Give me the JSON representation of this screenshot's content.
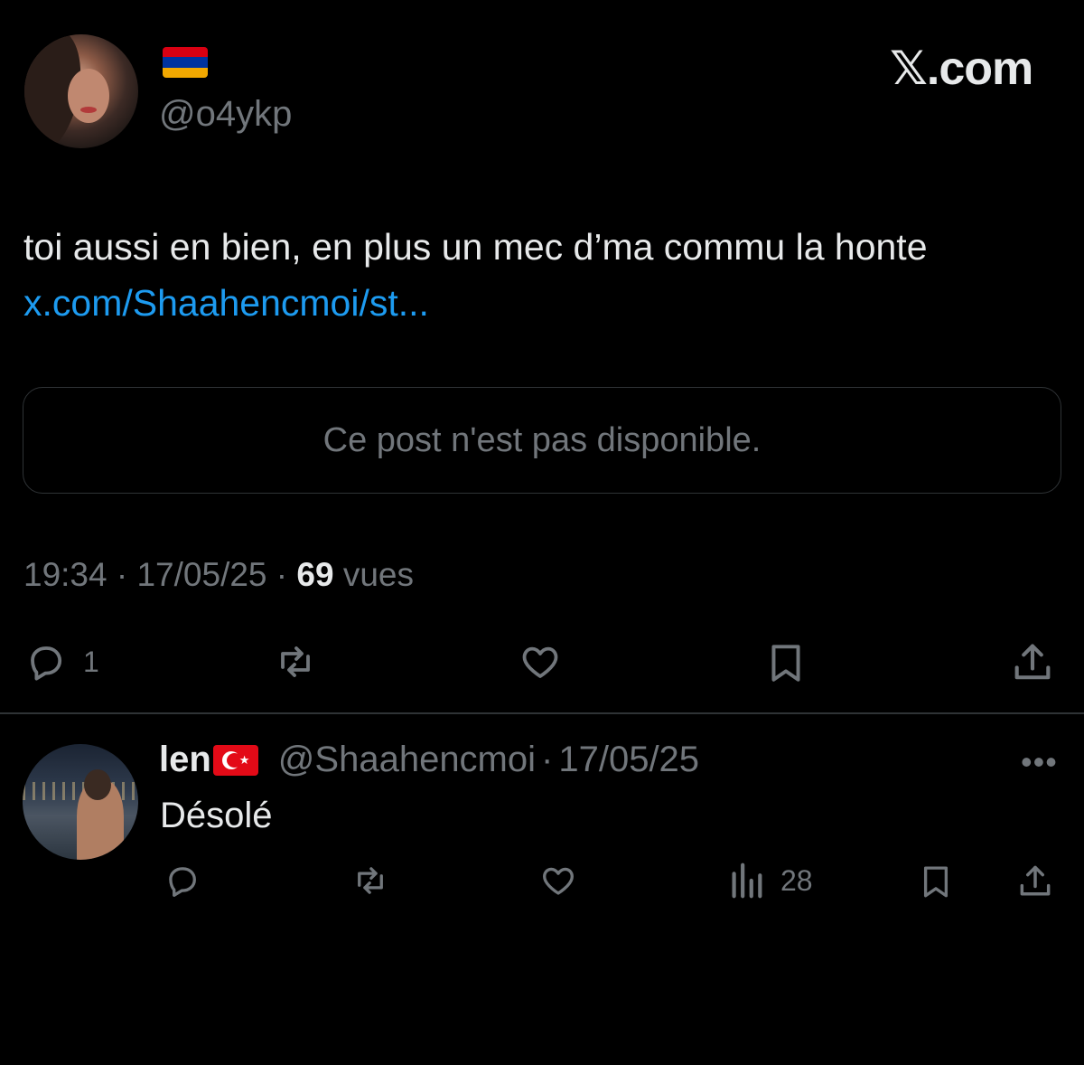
{
  "post": {
    "handle": "@o4ykp",
    "flag_colors": [
      "#d90012",
      "#0033a0",
      "#f2a800"
    ],
    "brand": "𝕏.com",
    "text": "toi aussi en bien, en plus un mec d’ma commu la honte ",
    "link": "x.com/Shaahencmoi/st...",
    "quote_unavailable": "Ce post n'est pas disponible.",
    "time": "19:34",
    "date": "17/05/25",
    "separator": "·",
    "views_count": "69",
    "views_label": "vues",
    "actions": {
      "reply_icon": "reply-icon",
      "reply_count": "1",
      "repost_icon": "repost-icon",
      "like_icon": "like-icon",
      "bookmark_icon": "bookmark-icon",
      "share_icon": "share-icon"
    }
  },
  "reply": {
    "name": "len",
    "flag": "turkey-flag",
    "handle": "@Shaahencmoi",
    "separator": "·",
    "date": "17/05/25",
    "more": "•••",
    "text": "Désolé",
    "views_count": "28"
  },
  "colors": {
    "background": "#000000",
    "text": "#e7e9ea",
    "muted": "#71767b",
    "link": "#1d9bf0",
    "border": "#2f3336"
  }
}
